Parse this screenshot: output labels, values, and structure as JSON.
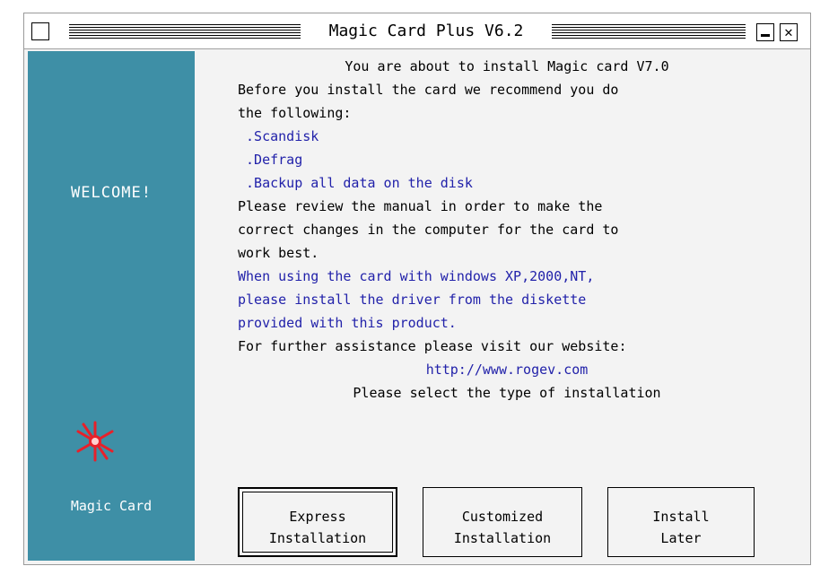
{
  "window": {
    "title": "Magic Card Plus V6.2",
    "min_glyph": "",
    "close_glyph": "✕"
  },
  "sidebar": {
    "welcome": "WELCOME!",
    "brand": "Magic Card",
    "star_icon": "red-star-icon",
    "color": "#3e8fa6"
  },
  "content": {
    "lines": [
      {
        "text": "You are about to install Magic card V7.0",
        "style": "center"
      },
      {
        "text": "Before you install the card we recommend you do",
        "style": "normal"
      },
      {
        "text": "the following:",
        "style": "normal"
      },
      {
        "text": " .Scandisk",
        "style": "blue"
      },
      {
        "text": " .Defrag",
        "style": "blue"
      },
      {
        "text": " .Backup all data on the disk",
        "style": "blue"
      },
      {
        "text": "Please review the manual in order to make the",
        "style": "normal"
      },
      {
        "text": "correct changes in the computer for the card to",
        "style": "normal"
      },
      {
        "text": "work best.",
        "style": "normal"
      },
      {
        "text": "When using the card with windows XP,2000,NT,",
        "style": "blue"
      },
      {
        "text": "please install the driver from the diskette",
        "style": "blue"
      },
      {
        "text": "provided with this product.",
        "style": "blue"
      },
      {
        "text": "For further assistance please visit our website:",
        "style": "normal"
      },
      {
        "text": "http://www.rogev.com",
        "style": "blue-center"
      },
      {
        "text": "Please select the type of installation",
        "style": "center"
      }
    ]
  },
  "buttons": {
    "express": [
      "Express",
      "Installation"
    ],
    "custom": [
      "Customized",
      "Installation"
    ],
    "later": [
      "Install",
      "Later"
    ]
  },
  "colors": {
    "accent_blue": "#2222aa",
    "star_red": "#e8202a"
  }
}
